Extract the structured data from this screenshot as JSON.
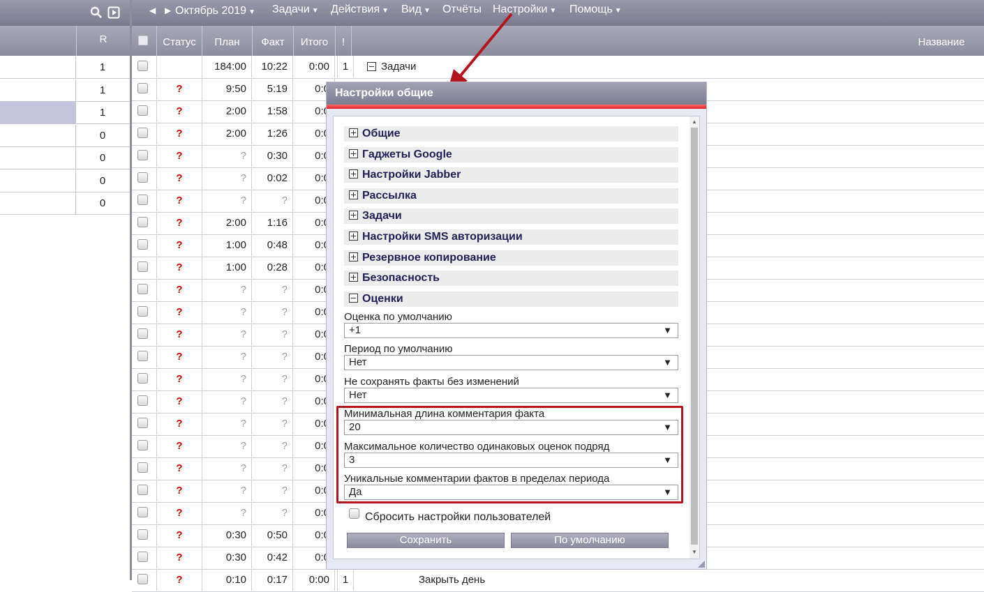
{
  "left": {
    "header_r": "R",
    "rows": [
      "1",
      "1",
      "1",
      "0",
      "0",
      "0",
      "0"
    ],
    "selected_index": 2
  },
  "menu": {
    "month": "Октябрь 2019",
    "items": [
      "Задачи",
      "Действия",
      "Вид",
      "Отчёты",
      "Настройки",
      "Помощь"
    ]
  },
  "grid": {
    "headers": {
      "status": "Статус",
      "plan": "План",
      "fact": "Факт",
      "total": "Итого",
      "excl": "!",
      "name": "Название"
    },
    "first_row": {
      "plan": "184:00",
      "fact": "10:22",
      "total": "0:00",
      "excl": "1",
      "name": "Задачи"
    },
    "rows": [
      {
        "plan": "9:50",
        "fact": "5:19",
        "total": "0:0"
      },
      {
        "plan": "2:00",
        "fact": "1:58",
        "total": "0:0"
      },
      {
        "plan": "2:00",
        "fact": "1:26",
        "total": "0:0"
      },
      {
        "plan": "?",
        "fact": "0:30",
        "total": "0:0"
      },
      {
        "plan": "?",
        "fact": "0:02",
        "total": "0:0"
      },
      {
        "plan": "?",
        "fact": "?",
        "total": "0:0"
      },
      {
        "plan": "2:00",
        "fact": "1:16",
        "total": "0:0"
      },
      {
        "plan": "1:00",
        "fact": "0:48",
        "total": "0:0"
      },
      {
        "plan": "1:00",
        "fact": "0:28",
        "total": "0:0"
      },
      {
        "plan": "?",
        "fact": "?",
        "total": "0:0"
      },
      {
        "plan": "?",
        "fact": "?",
        "total": "0:0"
      },
      {
        "plan": "?",
        "fact": "?",
        "total": "0:0"
      },
      {
        "plan": "?",
        "fact": "?",
        "total": "0:0"
      },
      {
        "plan": "?",
        "fact": "?",
        "total": "0:0"
      },
      {
        "plan": "?",
        "fact": "?",
        "total": "0:0"
      },
      {
        "plan": "?",
        "fact": "?",
        "total": "0:0"
      },
      {
        "plan": "?",
        "fact": "?",
        "total": "0:0"
      },
      {
        "plan": "?",
        "fact": "?",
        "total": "0:0"
      },
      {
        "plan": "?",
        "fact": "?",
        "total": "0:0"
      },
      {
        "plan": "?",
        "fact": "?",
        "total": "0:0"
      },
      {
        "plan": "0:30",
        "fact": "0:50",
        "total": "0:0"
      },
      {
        "plan": "0:30",
        "fact": "0:42",
        "total": "0:0"
      },
      {
        "plan": "0:10",
        "fact": "0:17",
        "total": "0:00",
        "excl": "1",
        "name": "Закрыть день"
      }
    ],
    "status_mark": "?"
  },
  "dialog": {
    "title": "Настройки общие",
    "sections": [
      "Общие",
      "Гаджеты Google",
      "Настройки Jabber",
      "Рассылка",
      "Задачи",
      "Настройки SMS авторизации",
      "Резервное копирование",
      "Безопасность",
      "Оценки"
    ],
    "expanded_section": "Оценки",
    "fields": [
      {
        "label": "Оценка по умолчанию",
        "value": "+1"
      },
      {
        "label": "Период по умолчанию",
        "value": "Нет"
      },
      {
        "label": "Не сохранять факты без изменений",
        "value": "Нет"
      },
      {
        "label": "Минимальная длина комментария факта",
        "value": "20"
      },
      {
        "label": "Максимальное количество одинаковых оценок подряд",
        "value": "3"
      },
      {
        "label": "Уникальные комментарии фактов в пределах периода",
        "value": "Да"
      }
    ],
    "reset_label": "Сбросить настройки пользователей",
    "save_label": "Сохранить",
    "default_label": "По умолчанию"
  },
  "colors": {
    "highlight": "#b3151e",
    "arrow": "#b3151e",
    "status_red": "#c40000"
  }
}
